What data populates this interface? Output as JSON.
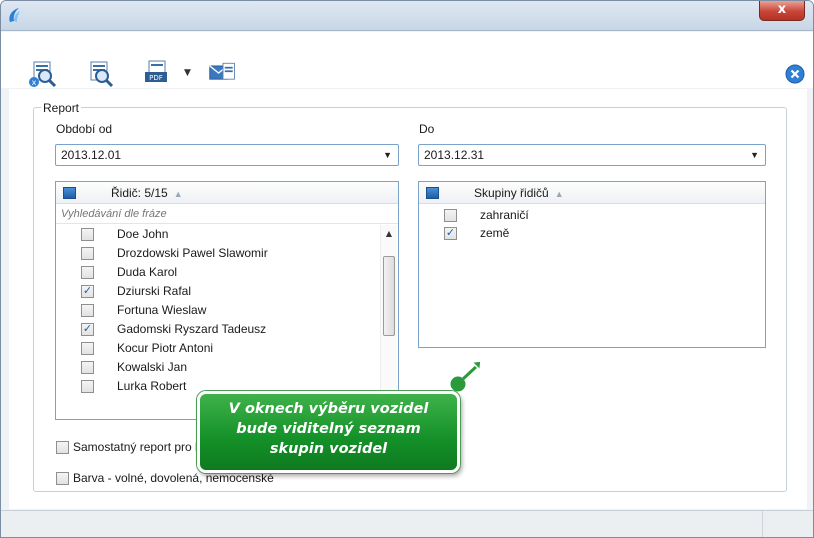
{
  "window": {
    "title": "",
    "close_glyph": "x"
  },
  "toolbar": {
    "buttons": [
      {
        "name": "report-delete-preview-icon"
      },
      {
        "name": "report-preview-icon"
      },
      {
        "name": "pdf-export-icon",
        "badge": "PDF"
      },
      {
        "name": "email-send-icon"
      }
    ],
    "dropdown_glyph": "▼"
  },
  "report": {
    "legend": "Report",
    "period_from_label": "Období od",
    "period_from_value": "2013.12.01",
    "period_to_label": "Do",
    "period_to_value": "2013.12.31",
    "drivers": {
      "header": "Řidič: 5/15",
      "search_placeholder": "Vyhledávání dle fráze",
      "items": [
        {
          "name": "Doe John",
          "checked": false
        },
        {
          "name": "Drozdowski Pawel Slawomir",
          "checked": false
        },
        {
          "name": "Duda Karol",
          "checked": false
        },
        {
          "name": "Dziurski Rafal",
          "checked": true
        },
        {
          "name": "Fortuna Wieslaw",
          "checked": false
        },
        {
          "name": "Gadomski Ryszard Tadeusz",
          "checked": true
        },
        {
          "name": "Kocur Piotr Antoni",
          "checked": false
        },
        {
          "name": "Kowalski Jan",
          "checked": false
        },
        {
          "name": "Lurka Robert",
          "checked": false
        }
      ]
    },
    "groups": {
      "header": "Skupiny řidičů",
      "items": [
        {
          "name": "zahraničí",
          "checked": false
        },
        {
          "name": "země",
          "checked": true
        }
      ]
    },
    "options": {
      "separate_report": "Samostatný report pro každého řidiče",
      "color": "Barva - volné, dovolená, nemocenské"
    }
  },
  "callout": {
    "text_line1": "V oknech výběru vozidel",
    "text_line2": "bude viditelný seznam",
    "text_line3": "skupin vozidel"
  },
  "colors": {
    "accent": "#1f5fa6",
    "callout_green": "#149028",
    "close_red": "#c9453a"
  }
}
